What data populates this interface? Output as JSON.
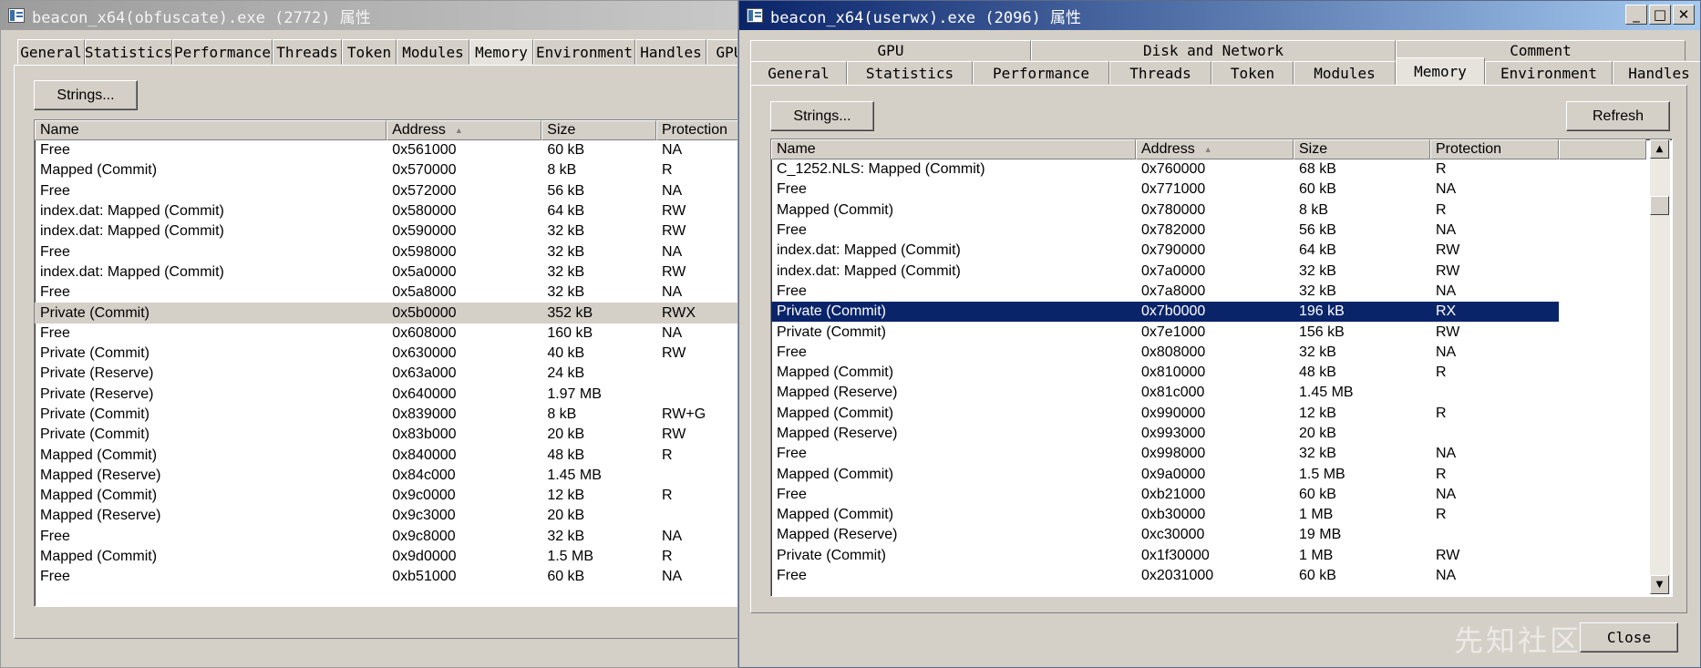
{
  "windows": [
    {
      "title": "beacon_x64(obfuscate).exe (2772) 属性",
      "title_buttons": [],
      "tab_rows": [
        [
          "General",
          "Statistics",
          "Performance",
          "Threads",
          "Token",
          "Modules",
          "Memory",
          "Environment",
          "Handles",
          "GPU"
        ]
      ],
      "active_tab": "Memory",
      "strings_button": "Strings...",
      "refresh_button": "",
      "close_button": "",
      "columns": [
        "Name",
        "Address",
        "Size",
        "Protection"
      ],
      "sorted_column": "Address",
      "selected_row": 8,
      "rows": [
        [
          "Free",
          "0x561000",
          "60 kB",
          "NA"
        ],
        [
          "Mapped (Commit)",
          "0x570000",
          "8 kB",
          "R"
        ],
        [
          "Free",
          "0x572000",
          "56 kB",
          "NA"
        ],
        [
          "index.dat: Mapped (Commit)",
          "0x580000",
          "64 kB",
          "RW"
        ],
        [
          "index.dat: Mapped (Commit)",
          "0x590000",
          "32 kB",
          "RW"
        ],
        [
          "Free",
          "0x598000",
          "32 kB",
          "NA"
        ],
        [
          "index.dat: Mapped (Commit)",
          "0x5a0000",
          "32 kB",
          "RW"
        ],
        [
          "Free",
          "0x5a8000",
          "32 kB",
          "NA"
        ],
        [
          "Private (Commit)",
          "0x5b0000",
          "352 kB",
          "RWX"
        ],
        [
          "Free",
          "0x608000",
          "160 kB",
          "NA"
        ],
        [
          "Private (Commit)",
          "0x630000",
          "40 kB",
          "RW"
        ],
        [
          "Private (Reserve)",
          "0x63a000",
          "24 kB",
          ""
        ],
        [
          "Private (Reserve)",
          "0x640000",
          "1.97 MB",
          ""
        ],
        [
          "Private (Commit)",
          "0x839000",
          "8 kB",
          "RW+G"
        ],
        [
          "Private (Commit)",
          "0x83b000",
          "20 kB",
          "RW"
        ],
        [
          "Mapped (Commit)",
          "0x840000",
          "48 kB",
          "R"
        ],
        [
          "Mapped (Reserve)",
          "0x84c000",
          "1.45 MB",
          ""
        ],
        [
          "Mapped (Commit)",
          "0x9c0000",
          "12 kB",
          "R"
        ],
        [
          "Mapped (Reserve)",
          "0x9c3000",
          "20 kB",
          ""
        ],
        [
          "Free",
          "0x9c8000",
          "32 kB",
          "NA"
        ],
        [
          "Mapped (Commit)",
          "0x9d0000",
          "1.5 MB",
          "R"
        ],
        [
          "Free",
          "0xb51000",
          "60 kB",
          "NA"
        ]
      ]
    },
    {
      "title": "beacon_x64(userwx).exe (2096) 属性",
      "title_buttons": [
        "_",
        "□",
        "✕"
      ],
      "tab_rows": [
        [
          "GPU",
          "Disk and Network",
          "Comment"
        ],
        [
          "General",
          "Statistics",
          "Performance",
          "Threads",
          "Token",
          "Modules",
          "Memory",
          "Environment",
          "Handles"
        ]
      ],
      "active_tab": "Memory",
      "strings_button": "Strings...",
      "refresh_button": "Refresh",
      "close_button": "Close",
      "columns": [
        "Name",
        "Address",
        "Size",
        "Protection"
      ],
      "sorted_column": "Address",
      "selected_row": 7,
      "rows": [
        [
          "C_1252.NLS: Mapped (Commit)",
          "0x760000",
          "68 kB",
          "R"
        ],
        [
          "Free",
          "0x771000",
          "60 kB",
          "NA"
        ],
        [
          "Mapped (Commit)",
          "0x780000",
          "8 kB",
          "R"
        ],
        [
          "Free",
          "0x782000",
          "56 kB",
          "NA"
        ],
        [
          "index.dat: Mapped (Commit)",
          "0x790000",
          "64 kB",
          "RW"
        ],
        [
          "index.dat: Mapped (Commit)",
          "0x7a0000",
          "32 kB",
          "RW"
        ],
        [
          "Free",
          "0x7a8000",
          "32 kB",
          "NA"
        ],
        [
          "Private (Commit)",
          "0x7b0000",
          "196 kB",
          "RX"
        ],
        [
          "Private (Commit)",
          "0x7e1000",
          "156 kB",
          "RW"
        ],
        [
          "Free",
          "0x808000",
          "32 kB",
          "NA"
        ],
        [
          "Mapped (Commit)",
          "0x810000",
          "48 kB",
          "R"
        ],
        [
          "Mapped (Reserve)",
          "0x81c000",
          "1.45 MB",
          ""
        ],
        [
          "Mapped (Commit)",
          "0x990000",
          "12 kB",
          "R"
        ],
        [
          "Mapped (Reserve)",
          "0x993000",
          "20 kB",
          ""
        ],
        [
          "Free",
          "0x998000",
          "32 kB",
          "NA"
        ],
        [
          "Mapped (Commit)",
          "0x9a0000",
          "1.5 MB",
          "R"
        ],
        [
          "Free",
          "0xb21000",
          "60 kB",
          "NA"
        ],
        [
          "Mapped (Commit)",
          "0xb30000",
          "1 MB",
          "R"
        ],
        [
          "Mapped (Reserve)",
          "0xc30000",
          "19 MB",
          ""
        ],
        [
          "Private (Commit)",
          "0x1f30000",
          "1 MB",
          "RW"
        ],
        [
          "Free",
          "0x2031000",
          "60 kB",
          "NA"
        ]
      ],
      "scrollbar_icons": [
        "scroll-up-icon",
        "scroll-down-icon"
      ]
    }
  ],
  "watermark": "先知社区",
  "colors": {
    "selection": "#0a246a",
    "inactive_selection": "#d4d0c8",
    "face": "#d4d0c8"
  }
}
